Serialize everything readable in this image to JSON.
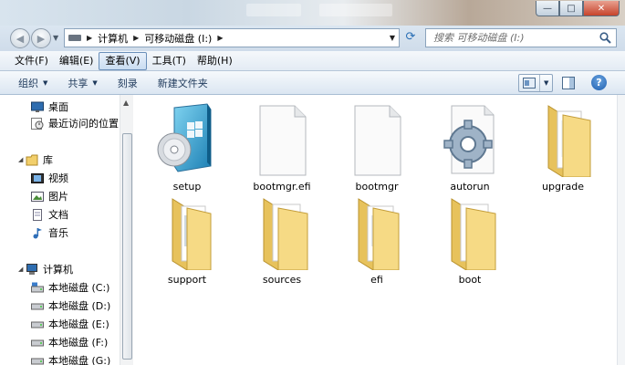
{
  "window": {
    "controls": {
      "minimize": "—",
      "maximize": "□",
      "close": "✕"
    }
  },
  "address": {
    "breadcrumbs": [
      "计算机",
      "可移动磁盘 (I:)"
    ],
    "search_placeholder": "搜索 可移动磁盘 (I:)"
  },
  "menu": [
    "文件(F)",
    "编辑(E)",
    "查看(V)",
    "工具(T)",
    "帮助(H)"
  ],
  "toolbar": {
    "organize": "组织",
    "share": "共享",
    "burn": "刻录",
    "new_folder": "新建文件夹",
    "help": "?"
  },
  "nav": {
    "desktop": "桌面",
    "recent": "最近访问的位置",
    "library": "库",
    "videos": "视频",
    "pictures": "图片",
    "documents": "文档",
    "music": "音乐",
    "computer": "计算机",
    "drives": [
      "本地磁盘 (C:)",
      "本地磁盘 (D:)",
      "本地磁盘 (E:)",
      "本地磁盘 (F:)",
      "本地磁盘 (G:)"
    ]
  },
  "files": [
    {
      "name": "setup",
      "icon": "setup-disc-icon"
    },
    {
      "name": "bootmgr.efi",
      "icon": "blank-file-icon"
    },
    {
      "name": "bootmgr",
      "icon": "blank-file-icon"
    },
    {
      "name": "autorun",
      "icon": "settings-file-icon"
    },
    {
      "name": "upgrade",
      "icon": "folder-icon"
    },
    {
      "name": "support",
      "icon": "folder-icon"
    },
    {
      "name": "sources",
      "icon": "folder-icon"
    },
    {
      "name": "efi",
      "icon": "folder-icon"
    },
    {
      "name": "boot",
      "icon": "folder-icon"
    }
  ],
  "colors": {
    "accent": "#1e395b",
    "folder": "#f3d77a"
  }
}
